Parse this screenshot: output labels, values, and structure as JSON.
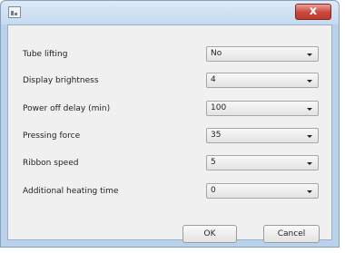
{
  "titlebar": {
    "app_icon": "application-icon",
    "close_icon": "close-icon",
    "close_glyph": "x",
    "close_color": "#c9463a"
  },
  "settings": [
    {
      "label": "Tube lifting",
      "value": "No"
    },
    {
      "label": "Display brightness",
      "value": "4"
    },
    {
      "label": "Power off delay (min)",
      "value": "100"
    },
    {
      "label": "Pressing force",
      "value": "35"
    },
    {
      "label": "Ribbon speed",
      "value": "5"
    },
    {
      "label": "Additional heating time",
      "value": "0"
    }
  ],
  "buttons": {
    "ok": "OK",
    "cancel": "Cancel"
  },
  "icons": {
    "dropdown": "chevron-down-icon"
  }
}
